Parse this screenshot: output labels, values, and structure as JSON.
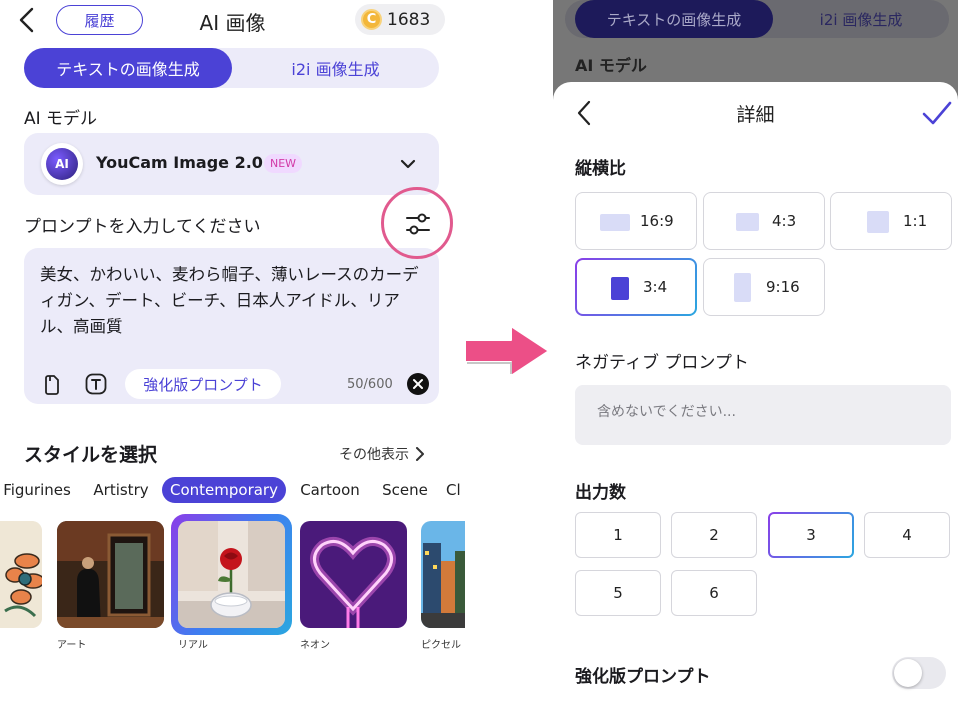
{
  "left": {
    "header": {
      "history_label": "履歴",
      "title": "AI 画像",
      "coins": "1683",
      "coin_symbol": "C"
    },
    "tabs": [
      {
        "label": "テキストの画像生成",
        "active": true
      },
      {
        "label": "i2i 画像生成",
        "active": false
      }
    ],
    "model_section_label": "AI モデル",
    "model": {
      "logo_text": "AI",
      "name": "YouCam Image 2.0",
      "badge": "NEW"
    },
    "prompt_section_label": "プロンプトを入力してください",
    "prompt": {
      "text": "美女、かわいい、麦わら帽子、薄いレースのカーディガン、デート、ビーチ、日本人アイドル、リアル、高画質",
      "enhance_label": "強化版プロンプト",
      "char_count": "50/600"
    },
    "styles": {
      "heading": "スタイルを選択",
      "more_label": "その他表示",
      "categories": [
        {
          "label": "Figurines",
          "active": false
        },
        {
          "label": "Artistry",
          "active": false
        },
        {
          "label": "Contemporary",
          "active": true
        },
        {
          "label": "Cartoon",
          "active": false
        },
        {
          "label": "Scene",
          "active": false
        },
        {
          "label": "Cl",
          "active": false
        }
      ],
      "thumbnails": [
        {
          "label": "",
          "selected": false
        },
        {
          "label": "アート",
          "selected": false
        },
        {
          "label": "リアル",
          "selected": true
        },
        {
          "label": "ネオン",
          "selected": false
        },
        {
          "label": "ピクセル",
          "selected": false
        }
      ]
    }
  },
  "right": {
    "background_tabs": [
      {
        "label": "テキストの画像生成",
        "active": true
      },
      {
        "label": "i2i 画像生成",
        "active": false
      }
    ],
    "background_model_label": "AI モデル",
    "sheet": {
      "title": "詳細",
      "aspect_label": "縦横比",
      "aspect_ratios": [
        {
          "label": "16:9",
          "selected": false
        },
        {
          "label": "4:3",
          "selected": false
        },
        {
          "label": "1:1",
          "selected": false
        },
        {
          "label": "3:4",
          "selected": true
        },
        {
          "label": "9:16",
          "selected": false
        }
      ],
      "negative_label": "ネガティブ プロンプト",
      "negative_placeholder": "含めないでください...",
      "output_label": "出力数",
      "output_counts": [
        {
          "label": "1",
          "selected": false
        },
        {
          "label": "2",
          "selected": false
        },
        {
          "label": "3",
          "selected": true
        },
        {
          "label": "4",
          "selected": false
        },
        {
          "label": "5",
          "selected": false
        },
        {
          "label": "6",
          "selected": false
        }
      ],
      "enhance_label": "強化版プロンプト",
      "enhance_on": false
    }
  },
  "colors": {
    "accent": "#4b42d6",
    "accent_light": "#ecebf9",
    "highlight_ring": "#e15a8e",
    "arrow": "#ec4f87"
  }
}
